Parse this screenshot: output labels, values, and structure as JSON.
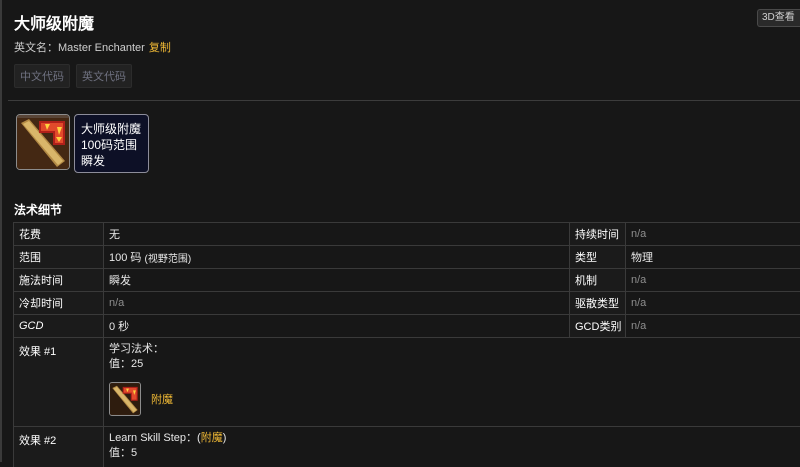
{
  "spell": {
    "title": "大师级附魔",
    "english_label": "英文名：Master Enchanter",
    "copy_label": "复制",
    "view3d_label": "3D查看",
    "code_tabs": [
      "中文代码",
      "英文代码"
    ],
    "icon": "enchanting-rod-icon",
    "tooltip": {
      "name": "大师级附魔",
      "range": "100码范围",
      "cast": "瞬发"
    }
  },
  "details": {
    "section_title": "法术细节",
    "rows": [
      {
        "label": "花费",
        "value": "无",
        "label2": "持续时间",
        "value2": "n/a"
      },
      {
        "label": "范围",
        "value": "100 码",
        "value_note": "(视野范围)",
        "label2": "类型",
        "value2": "物理"
      },
      {
        "label": "施法时间",
        "value": "瞬发",
        "label2": "机制",
        "value2": "n/a"
      },
      {
        "label": "冷却时间",
        "value": "n/a",
        "label2": "驱散类型",
        "value2": "n/a"
      },
      {
        "label": "GCD",
        "value": "0 秒",
        "label2": "GCD类别",
        "value2": "n/a"
      }
    ],
    "effects": [
      {
        "label": "效果 #1",
        "line1": "学习法术：",
        "line2": "值：25",
        "sub_spell_name": "附魔",
        "sub_spell_icon": "enchanting-rod-icon"
      },
      {
        "label": "效果 #2",
        "line1_prefix": "Learn Skill Step：(",
        "line1_link": "附魔",
        "line1_suffix": ")",
        "line2": "值：5"
      }
    ]
  }
}
